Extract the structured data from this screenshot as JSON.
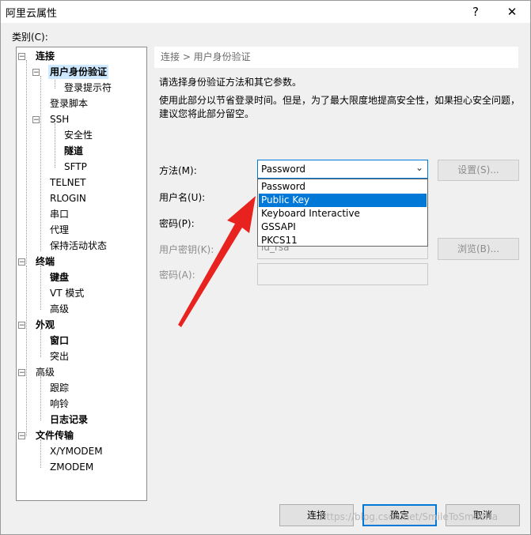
{
  "window": {
    "title": "阿里云属性",
    "help_btn": "?",
    "close_btn": "✕"
  },
  "category_label": "类别(C):",
  "tree": [
    {
      "label": "连接",
      "bold": true,
      "expander": "−"
    },
    {
      "label": "用户身份验证",
      "bold": true,
      "expander": "−",
      "selected": true
    },
    {
      "label": "登录提示符"
    },
    {
      "label": "登录脚本"
    },
    {
      "label": "SSH",
      "expander": "−"
    },
    {
      "label": "安全性"
    },
    {
      "label": "隧道",
      "bold": true
    },
    {
      "label": "SFTP"
    },
    {
      "label": "TELNET"
    },
    {
      "label": "RLOGIN"
    },
    {
      "label": "串口"
    },
    {
      "label": "代理"
    },
    {
      "label": "保持活动状态"
    },
    {
      "label": "终端",
      "bold": true,
      "expander": "−"
    },
    {
      "label": "键盘",
      "bold": true
    },
    {
      "label": "VT 模式"
    },
    {
      "label": "高级"
    },
    {
      "label": "外观",
      "bold": true,
      "expander": "−"
    },
    {
      "label": "窗口",
      "bold": true
    },
    {
      "label": "突出"
    },
    {
      "label": "高级",
      "expander": "−"
    },
    {
      "label": "跟踪"
    },
    {
      "label": "响铃"
    },
    {
      "label": "日志记录",
      "bold": true
    },
    {
      "label": "文件传输",
      "bold": true,
      "expander": "−"
    },
    {
      "label": "X/YMODEM"
    },
    {
      "label": "ZMODEM"
    }
  ],
  "breadcrumb": "连接 > 用户身份验证",
  "description": {
    "line1": "请选择身份验证方法和其它参数。",
    "line2": "使用此部分以节省登录时间。但是，为了最大限度地提高安全性，如果担心安全问题，",
    "line3": "建议您将此部分留空。"
  },
  "fields": {
    "method_label": "方法(M):",
    "method_value": "Password",
    "username_label": "用户名(U):",
    "password_label": "密码(P):",
    "user_key_label": "用户密钥(K):",
    "user_key_value": "id_rsa",
    "passphrase_label": "密码(A):"
  },
  "buttons": {
    "settings": "设置(S)...",
    "browse": "浏览(B)...",
    "connect": "连接",
    "ok": "确定",
    "cancel": "取消"
  },
  "dropdown_options": [
    "Password",
    "Public Key",
    "Keyboard Interactive",
    "GSSAPI",
    "PKCS11"
  ],
  "dropdown_highlighted": "Public Key",
  "annotation_color": "#e8231f",
  "watermark": "https://blog.csdn.net/SmileToSmileHa"
}
